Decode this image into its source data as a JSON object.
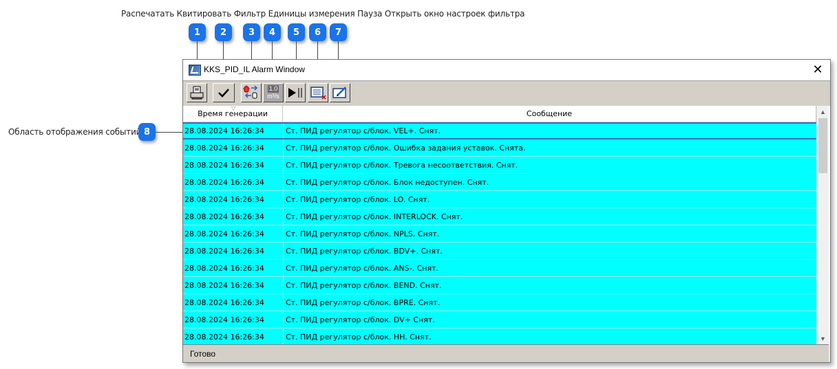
{
  "callouts": {
    "top_text": "Распечатать Квитировать Фильтр Единицы измерения Пауза Открыть окно настроек фильтра",
    "events_label": "Область отображения событий",
    "badges": [
      "1",
      "2",
      "3",
      "4",
      "5",
      "6",
      "7",
      "8"
    ]
  },
  "window": {
    "title": "KKS_PID_IL Alarm Window",
    "close_glyph": "✕"
  },
  "toolbar": {
    "units_value": "1.0",
    "units_label": "m³/s"
  },
  "table": {
    "columns": [
      "Время генерации",
      "Сообщение"
    ],
    "rows": [
      {
        "time": "28.08.2024 16:26:34",
        "message": "Ст. ПИД регулятор с/блок. VEL+. Снят."
      },
      {
        "time": "28.08.2024 16:26:34",
        "message": "Ст. ПИД регулятор с/блок. Ошибка задания уставок. Снята."
      },
      {
        "time": "28.08.2024 16:26:34",
        "message": "Ст. ПИД регулятор с/блок. Тревога несоответствия. Снят."
      },
      {
        "time": "28.08.2024 16:26:34",
        "message": "Ст. ПИД регулятор с/блок. Блок недоступен. Снят."
      },
      {
        "time": "28.08.2024 16:26:34",
        "message": "Ст. ПИД регулятор с/блок. LO. Снят."
      },
      {
        "time": "28.08.2024 16:26:34",
        "message": "Ст. ПИД регулятор с/блок. INTERLOCK. Снят."
      },
      {
        "time": "28.08.2024 16:26:34",
        "message": "Ст. ПИД регулятор с/блок. NPLS. Снят."
      },
      {
        "time": "28.08.2024 16:26:34",
        "message": "Ст. ПИД регулятор с/блок. BDV+. Снят."
      },
      {
        "time": "28.08.2024 16:26:34",
        "message": "Ст. ПИД регулятор с/блок. ANS-. Снят."
      },
      {
        "time": "28.08.2024 16:26:34",
        "message": "Ст. ПИД регулятор с/блок. BEND. Снят."
      },
      {
        "time": "28.08.2024 16:26:34",
        "message": "Ст. ПИД регулятор с/блок. BPRE. Снят."
      },
      {
        "time": "28.08.2024 16:26:34",
        "message": "Ст. ПИД регулятор с/блок. DV+ Снят."
      },
      {
        "time": "28.08.2024 16:26:34",
        "message": "Ст. ПИД регулятор с/блок. HH. Снят."
      }
    ]
  },
  "status": {
    "text": "Готово"
  },
  "colors": {
    "row_bg": "#00ffff",
    "badge": "#1a73e8",
    "selection_border": "#3b6fb6"
  }
}
